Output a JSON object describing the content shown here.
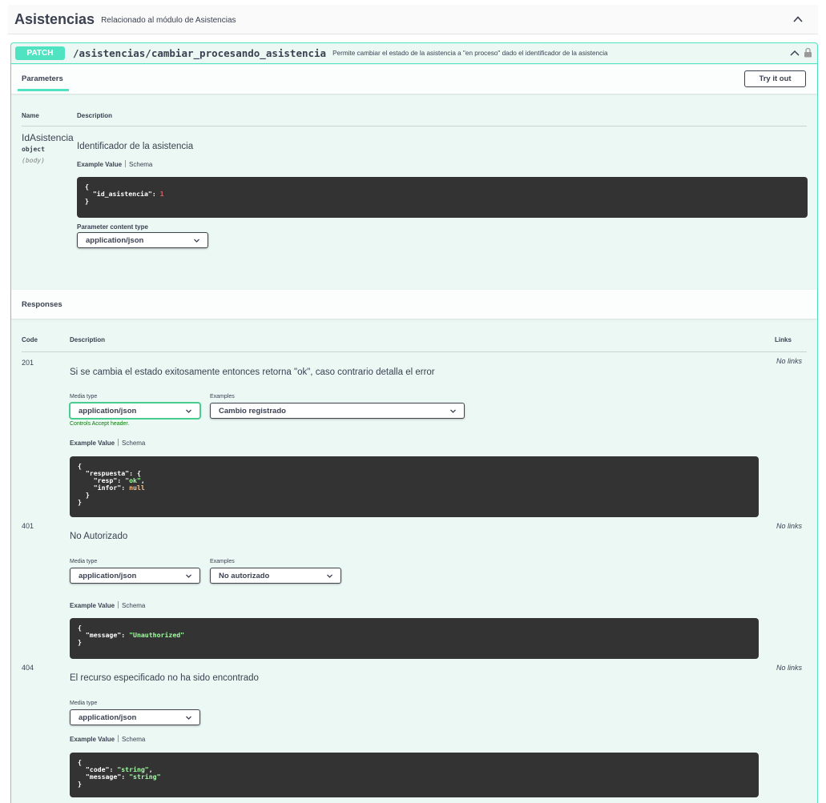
{
  "tag": {
    "title": "Asistencias",
    "description": "Relacionado al módulo de Asistencias"
  },
  "operation": {
    "method": "PATCH",
    "path": "/asistencias/cambiar_procesando_asistencia",
    "description": "Permite cambiar el estado de la asistencia a \"en proceso\" dado el identificador de la asistencia",
    "color": "#50e3c2"
  },
  "parameters": {
    "section_title": "Parameters",
    "try_button": "Try it out",
    "col_name": "Name",
    "col_description": "Description",
    "items": [
      {
        "name": "IdAsistencia",
        "type": "object",
        "in": "(body)",
        "description": "Identificador de la asistencia",
        "example_tab": "Example Value",
        "schema_tab": "Schema",
        "example_key": "\"id_asistencia\"",
        "example_value": "1",
        "content_type_label": "Parameter content type",
        "content_type": "application/json"
      }
    ]
  },
  "responses": {
    "section_title": "Responses",
    "col_code": "Code",
    "col_description": "Description",
    "col_links": "Links",
    "media_type_label": "Media type",
    "examples_label": "Examples",
    "example_tab": "Example Value",
    "schema_tab": "Schema",
    "accept_note": "Controls Accept header.",
    "items": [
      {
        "code": "201",
        "description": "Si se cambia el estado exitosamente entonces retorna \"ok\", caso contrario detalla el error",
        "media_type": "application/json",
        "example_name": "Cambio registrado",
        "links": "No links",
        "json": {
          "k_respuesta": "\"respuesta\"",
          "k_resp": "\"resp\"",
          "v_resp": "\"ok\"",
          "k_infor": "\"infor\"",
          "v_infor": "null"
        }
      },
      {
        "code": "401",
        "description": "No Autorizado",
        "media_type": "application/json",
        "example_name": "No autorizado",
        "links": "No links",
        "json": {
          "k_message": "\"message\"",
          "v_message": "\"Unauthorized\""
        }
      },
      {
        "code": "404",
        "description": "El recurso especificado no ha sido encontrado",
        "media_type": "application/json",
        "links": "No links",
        "json": {
          "k_code": "\"code\"",
          "v_code": "\"string\"",
          "k_message": "\"message\"",
          "v_message": "\"string\""
        }
      }
    ]
  }
}
